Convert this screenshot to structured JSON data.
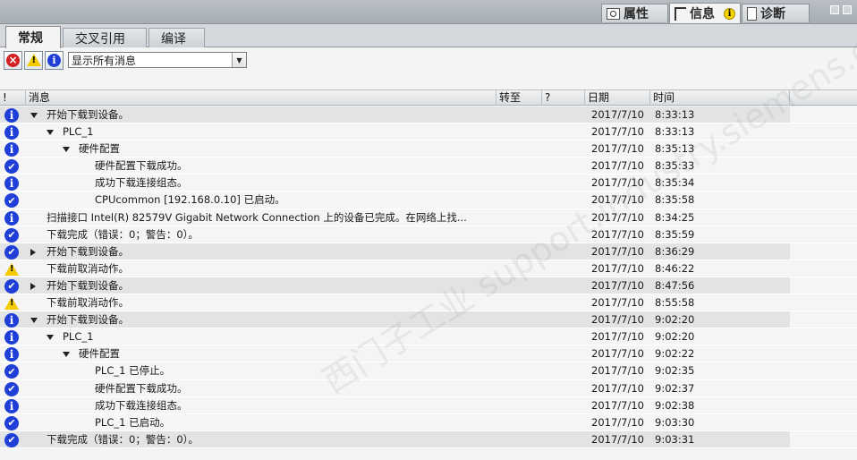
{
  "inspector_tabs": [
    {
      "label": "属性",
      "icon": "properties-icon"
    },
    {
      "label": "信息",
      "icon": "info-icon"
    },
    {
      "label": "诊断",
      "icon": "diagnostics-icon"
    }
  ],
  "info_badge": "i",
  "sub_tabs": [
    "常规",
    "交叉引用",
    "编译"
  ],
  "filter": {
    "error_icon": "×",
    "warning_icon": "!",
    "info_icon": "i",
    "selected": "显示所有消息"
  },
  "columns": {
    "severity": "!",
    "message": "消息",
    "goto": "转至",
    "help": "?",
    "date": "日期",
    "time": "时间"
  },
  "rows": [
    {
      "sev": "info",
      "expander": "open",
      "level": 0,
      "msg": "开始下载到设备。",
      "date": "2017/7/10",
      "time": "8:33:13",
      "hl": true
    },
    {
      "sev": "info",
      "expander": "open",
      "level": 1,
      "msg": "PLC_1",
      "date": "2017/7/10",
      "time": "8:33:13",
      "hl": false
    },
    {
      "sev": "info",
      "expander": "open",
      "level": 2,
      "msg": "硬件配置",
      "date": "2017/7/10",
      "time": "8:35:13",
      "hl": false
    },
    {
      "sev": "ok",
      "expander": "",
      "level": 3,
      "msg": "硬件配置下载成功。",
      "date": "2017/7/10",
      "time": "8:35:33",
      "hl": false
    },
    {
      "sev": "info",
      "expander": "",
      "level": 3,
      "msg": "成功下载连接组态。",
      "date": "2017/7/10",
      "time": "8:35:34",
      "hl": false
    },
    {
      "sev": "ok",
      "expander": "",
      "level": 3,
      "msg": "CPUcommon [192.168.0.10] 已启动。",
      "date": "2017/7/10",
      "time": "8:35:58",
      "hl": false
    },
    {
      "sev": "info",
      "expander": "",
      "level": 0,
      "msg": "扫描接口 Intel(R) 82579V Gigabit Network Connection 上的设备已完成。在网络上找...",
      "date": "2017/7/10",
      "time": "8:34:25",
      "hl": false
    },
    {
      "sev": "ok",
      "expander": "",
      "level": 0,
      "msg": "下载完成（错误：0；警告：0）。",
      "date": "2017/7/10",
      "time": "8:35:59",
      "hl": false
    },
    {
      "sev": "ok",
      "expander": "closed",
      "level": 0,
      "msg": "开始下载到设备。",
      "date": "2017/7/10",
      "time": "8:36:29",
      "hl": true
    },
    {
      "sev": "warn",
      "expander": "",
      "level": 0,
      "msg": "下载前取消动作。",
      "date": "2017/7/10",
      "time": "8:46:22",
      "hl": false
    },
    {
      "sev": "ok",
      "expander": "closed",
      "level": 0,
      "msg": "开始下载到设备。",
      "date": "2017/7/10",
      "time": "8:47:56",
      "hl": true
    },
    {
      "sev": "warn",
      "expander": "",
      "level": 0,
      "msg": "下载前取消动作。",
      "date": "2017/7/10",
      "time": "8:55:58",
      "hl": false
    },
    {
      "sev": "info",
      "expander": "open",
      "level": 0,
      "msg": "开始下载到设备。",
      "date": "2017/7/10",
      "time": "9:02:20",
      "hl": true
    },
    {
      "sev": "info",
      "expander": "open",
      "level": 1,
      "msg": "PLC_1",
      "date": "2017/7/10",
      "time": "9:02:20",
      "hl": false
    },
    {
      "sev": "info",
      "expander": "open",
      "level": 2,
      "msg": "硬件配置",
      "date": "2017/7/10",
      "time": "9:02:22",
      "hl": false
    },
    {
      "sev": "ok",
      "expander": "",
      "level": 3,
      "msg": "PLC_1 已停止。",
      "date": "2017/7/10",
      "time": "9:02:35",
      "hl": false
    },
    {
      "sev": "ok",
      "expander": "",
      "level": 3,
      "msg": "硬件配置下载成功。",
      "date": "2017/7/10",
      "time": "9:02:37",
      "hl": false
    },
    {
      "sev": "info",
      "expander": "",
      "level": 3,
      "msg": "成功下载连接组态。",
      "date": "2017/7/10",
      "time": "9:02:38",
      "hl": false
    },
    {
      "sev": "ok",
      "expander": "",
      "level": 3,
      "msg": "PLC_1 已启动。",
      "date": "2017/7/10",
      "time": "9:03:30",
      "hl": false
    },
    {
      "sev": "ok",
      "expander": "",
      "level": 0,
      "msg": "下载完成（错误：0；警告：0）。",
      "date": "2017/7/10",
      "time": "9:03:31",
      "hl": true
    }
  ],
  "watermark": "西门子工业 support.industry.siemens.com/cs",
  "colors": {
    "info": "#1f3fd6",
    "warning": "#f3cb00",
    "error": "#d42020",
    "row_highlight": "#e1e3e5"
  }
}
